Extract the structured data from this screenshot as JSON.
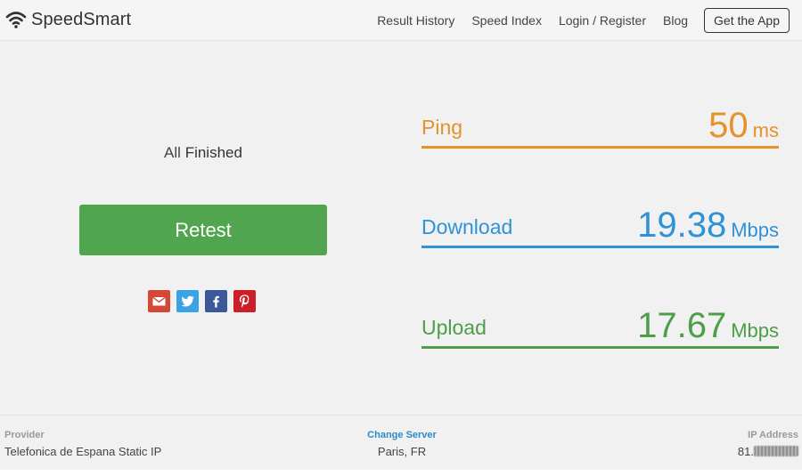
{
  "header": {
    "brand": "SpeedSmart",
    "nav": [
      {
        "label": "Result History"
      },
      {
        "label": "Speed Index"
      },
      {
        "label": "Login / Register"
      },
      {
        "label": "Blog"
      }
    ],
    "cta_label": "Get the App"
  },
  "main": {
    "status_prefix": "All",
    "status_word": "Finished",
    "retest_label": "Retest",
    "share_icons": [
      "mail-icon",
      "twitter-icon",
      "facebook-icon",
      "pinterest-icon"
    ]
  },
  "metrics": {
    "ping": {
      "label": "Ping",
      "value": "50",
      "unit": "ms",
      "color": "#e69228"
    },
    "download": {
      "label": "Download",
      "value": "19.38",
      "unit": "Mbps",
      "color": "#2d93d6"
    },
    "upload": {
      "label": "Upload",
      "value": "17.67",
      "unit": "Mbps",
      "color": "#4c9e48"
    }
  },
  "footer": {
    "provider_label": "Provider",
    "provider_value": "Telefonica de Espana Static IP",
    "server_label": "Change Server",
    "server_value": "Paris, FR",
    "ip_label": "IP Address",
    "ip_prefix": "81."
  },
  "colors": {
    "retest": "#51a54f",
    "background": "#f1f1f1"
  }
}
